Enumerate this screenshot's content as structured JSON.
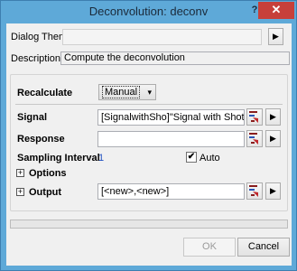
{
  "window": {
    "title": "Deconvolution: deconv",
    "help_label": "?",
    "close_label": "✕"
  },
  "theme": {
    "label": "Dialog Theme",
    "value": "",
    "arrow": "▶"
  },
  "description": {
    "label": "Description",
    "text": "Compute the deconvolution"
  },
  "recalculate": {
    "label": "Recalculate",
    "selected": "Manual",
    "caret": "▾"
  },
  "signal": {
    "label": "Signal",
    "value": "[SignalwithSho]\"Signal with Shot Noise\"!E",
    "arrow": "▶"
  },
  "response": {
    "label": "Response",
    "value": "",
    "arrow": "▶"
  },
  "sampling": {
    "label": "Sampling Interval",
    "value": "1",
    "auto_label": "Auto",
    "auto_checked": true,
    "check_glyph": "✔"
  },
  "options": {
    "label": "Options",
    "expander": "+"
  },
  "output": {
    "label": "Output",
    "expander": "+",
    "value": "[<new>,<new>]",
    "arrow": "▶"
  },
  "progress": 0,
  "footer": {
    "ok_label": "OK",
    "cancel_label": "Cancel"
  },
  "colors": {
    "window_frame": "#5ea9d8",
    "close_button": "#c7403a",
    "client_bg": "#f0f0f0",
    "link_value": "#1f4fbf"
  }
}
